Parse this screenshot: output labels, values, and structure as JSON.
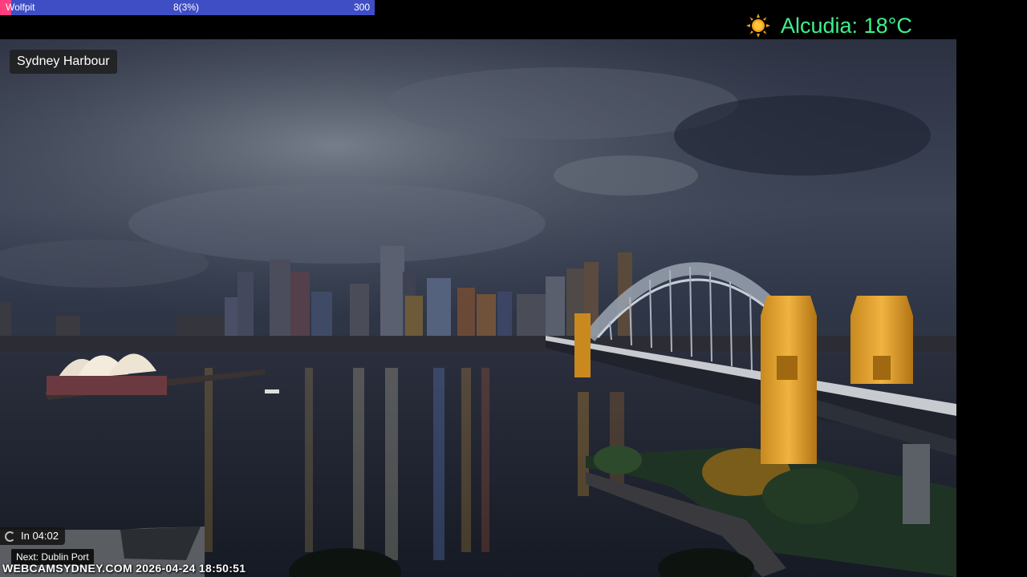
{
  "progress": {
    "name": "Wolfpit",
    "count_text": "8(3%)",
    "total": "300",
    "fraction": 0.03,
    "colors": {
      "bar": "#3f4ec4",
      "fill": "#ff3d7f"
    }
  },
  "weather": {
    "icon": "sun-icon",
    "text": "Alcudia: 18°C",
    "color": "#3ef08a"
  },
  "camera": {
    "title": "Sydney Harbour",
    "countdown_icon": "loading-ring-icon",
    "countdown": "In 04:02",
    "next": "Next: Dublin Port",
    "watermark": "WEBCAMSYDNEY.COM 2026-04-24 18:50:51"
  }
}
